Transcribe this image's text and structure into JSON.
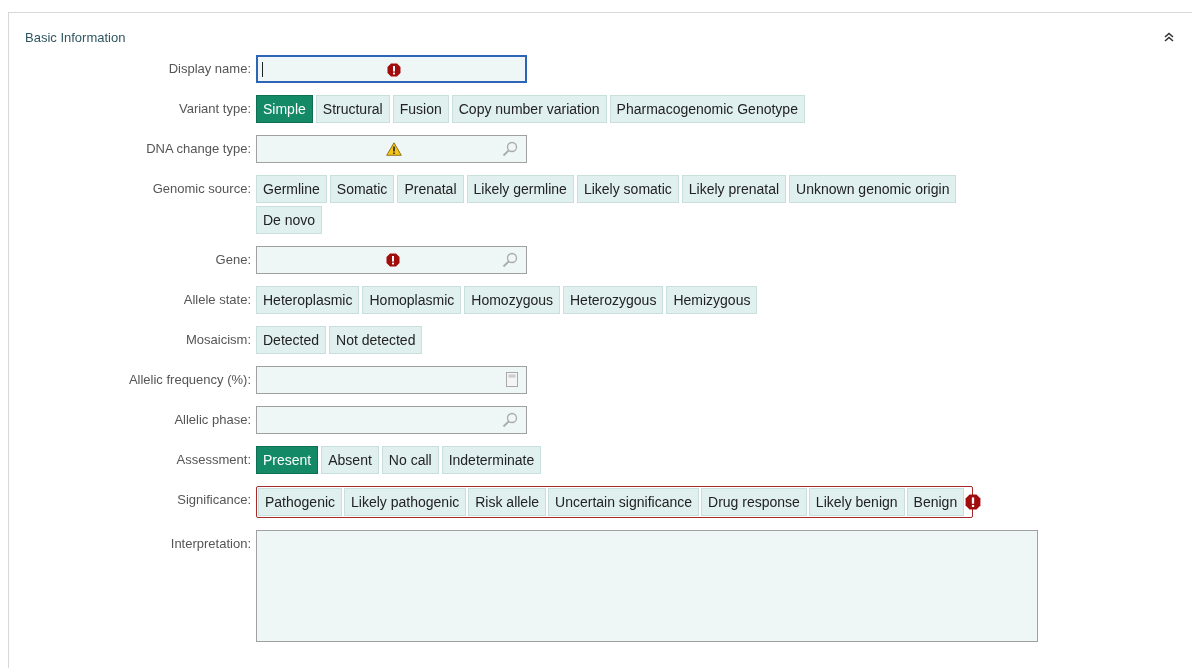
{
  "panel": {
    "title": "Basic Information",
    "expanded": true
  },
  "rows": [
    {
      "kind": "field",
      "label": "Display name:",
      "focused": true,
      "error": true
    },
    {
      "kind": "choices",
      "label": "Variant type:",
      "options": [
        {
          "label": "Simple",
          "selected": true
        },
        {
          "label": "Structural",
          "selected": false
        },
        {
          "label": "Fusion",
          "selected": false
        },
        {
          "label": "Copy number variation",
          "selected": false
        },
        {
          "label": "Pharmacogenomic Genotype",
          "selected": false
        }
      ]
    },
    {
      "kind": "field",
      "label": "DNA change type:",
      "focused": false,
      "warning": true,
      "lookup": true
    },
    {
      "kind": "choices",
      "label": "Genomic source:",
      "options": [
        {
          "label": "Germline",
          "selected": false
        },
        {
          "label": "Somatic",
          "selected": false
        },
        {
          "label": "Prenatal",
          "selected": false
        },
        {
          "label": "Likely germline",
          "selected": false
        },
        {
          "label": "Likely somatic",
          "selected": false
        },
        {
          "label": "Likely prenatal",
          "selected": false
        },
        {
          "label": "Unknown genomic origin",
          "selected": false
        },
        {
          "label": "De novo",
          "selected": false
        }
      ]
    },
    {
      "kind": "field",
      "label": "Gene:",
      "focused": false,
      "error": true,
      "lookup": true
    },
    {
      "kind": "choices",
      "label": "Allele state:",
      "options": [
        {
          "label": "Heteroplasmic",
          "selected": false
        },
        {
          "label": "Homoplasmic",
          "selected": false
        },
        {
          "label": "Homozygous",
          "selected": false
        },
        {
          "label": "Heterozygous",
          "selected": false
        },
        {
          "label": "Hemizygous",
          "selected": false
        }
      ]
    },
    {
      "kind": "choices",
      "label": "Mosaicism:",
      "options": [
        {
          "label": "Detected",
          "selected": false
        },
        {
          "label": "Not detected",
          "selected": false
        }
      ]
    },
    {
      "kind": "field",
      "label": "Allelic frequency (%):",
      "focused": false,
      "numeric": true
    },
    {
      "kind": "field",
      "label": "Allelic phase:",
      "focused": false,
      "lookup": true
    },
    {
      "kind": "choices",
      "label": "Assessment:",
      "options": [
        {
          "label": "Present",
          "selected": true
        },
        {
          "label": "Absent",
          "selected": false
        },
        {
          "label": "No call",
          "selected": false
        },
        {
          "label": "Indeterminate",
          "selected": false
        }
      ]
    },
    {
      "kind": "choices",
      "label": "Significance:",
      "invalid": true,
      "options": [
        {
          "label": "Pathogenic",
          "selected": false
        },
        {
          "label": "Likely pathogenic",
          "selected": false
        },
        {
          "label": "Risk allele",
          "selected": false
        },
        {
          "label": "Uncertain significance",
          "selected": false
        },
        {
          "label": "Drug response",
          "selected": false
        },
        {
          "label": "Likely benign",
          "selected": false
        },
        {
          "label": "Benign",
          "selected": false
        }
      ]
    },
    {
      "kind": "textarea",
      "label": "Interpretation:"
    }
  ]
}
